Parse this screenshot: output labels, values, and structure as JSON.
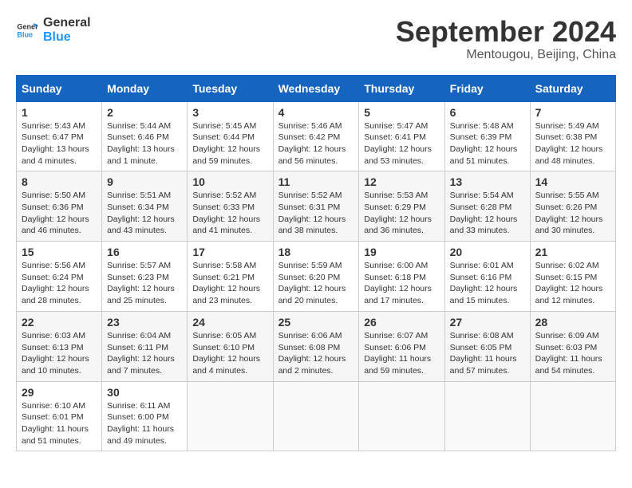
{
  "logo": {
    "line1": "General",
    "line2": "Blue"
  },
  "title": "September 2024",
  "location": "Mentougou, Beijing, China",
  "weekdays": [
    "Sunday",
    "Monday",
    "Tuesday",
    "Wednesday",
    "Thursday",
    "Friday",
    "Saturday"
  ],
  "weeks": [
    [
      {
        "day": "1",
        "info": "Sunrise: 5:43 AM\nSunset: 6:47 PM\nDaylight: 13 hours\nand 4 minutes."
      },
      {
        "day": "2",
        "info": "Sunrise: 5:44 AM\nSunset: 6:46 PM\nDaylight: 13 hours\nand 1 minute."
      },
      {
        "day": "3",
        "info": "Sunrise: 5:45 AM\nSunset: 6:44 PM\nDaylight: 12 hours\nand 59 minutes."
      },
      {
        "day": "4",
        "info": "Sunrise: 5:46 AM\nSunset: 6:42 PM\nDaylight: 12 hours\nand 56 minutes."
      },
      {
        "day": "5",
        "info": "Sunrise: 5:47 AM\nSunset: 6:41 PM\nDaylight: 12 hours\nand 53 minutes."
      },
      {
        "day": "6",
        "info": "Sunrise: 5:48 AM\nSunset: 6:39 PM\nDaylight: 12 hours\nand 51 minutes."
      },
      {
        "day": "7",
        "info": "Sunrise: 5:49 AM\nSunset: 6:38 PM\nDaylight: 12 hours\nand 48 minutes."
      }
    ],
    [
      {
        "day": "8",
        "info": "Sunrise: 5:50 AM\nSunset: 6:36 PM\nDaylight: 12 hours\nand 46 minutes."
      },
      {
        "day": "9",
        "info": "Sunrise: 5:51 AM\nSunset: 6:34 PM\nDaylight: 12 hours\nand 43 minutes."
      },
      {
        "day": "10",
        "info": "Sunrise: 5:52 AM\nSunset: 6:33 PM\nDaylight: 12 hours\nand 41 minutes."
      },
      {
        "day": "11",
        "info": "Sunrise: 5:52 AM\nSunset: 6:31 PM\nDaylight: 12 hours\nand 38 minutes."
      },
      {
        "day": "12",
        "info": "Sunrise: 5:53 AM\nSunset: 6:29 PM\nDaylight: 12 hours\nand 36 minutes."
      },
      {
        "day": "13",
        "info": "Sunrise: 5:54 AM\nSunset: 6:28 PM\nDaylight: 12 hours\nand 33 minutes."
      },
      {
        "day": "14",
        "info": "Sunrise: 5:55 AM\nSunset: 6:26 PM\nDaylight: 12 hours\nand 30 minutes."
      }
    ],
    [
      {
        "day": "15",
        "info": "Sunrise: 5:56 AM\nSunset: 6:24 PM\nDaylight: 12 hours\nand 28 minutes."
      },
      {
        "day": "16",
        "info": "Sunrise: 5:57 AM\nSunset: 6:23 PM\nDaylight: 12 hours\nand 25 minutes."
      },
      {
        "day": "17",
        "info": "Sunrise: 5:58 AM\nSunset: 6:21 PM\nDaylight: 12 hours\nand 23 minutes."
      },
      {
        "day": "18",
        "info": "Sunrise: 5:59 AM\nSunset: 6:20 PM\nDaylight: 12 hours\nand 20 minutes."
      },
      {
        "day": "19",
        "info": "Sunrise: 6:00 AM\nSunset: 6:18 PM\nDaylight: 12 hours\nand 17 minutes."
      },
      {
        "day": "20",
        "info": "Sunrise: 6:01 AM\nSunset: 6:16 PM\nDaylight: 12 hours\nand 15 minutes."
      },
      {
        "day": "21",
        "info": "Sunrise: 6:02 AM\nSunset: 6:15 PM\nDaylight: 12 hours\nand 12 minutes."
      }
    ],
    [
      {
        "day": "22",
        "info": "Sunrise: 6:03 AM\nSunset: 6:13 PM\nDaylight: 12 hours\nand 10 minutes."
      },
      {
        "day": "23",
        "info": "Sunrise: 6:04 AM\nSunset: 6:11 PM\nDaylight: 12 hours\nand 7 minutes."
      },
      {
        "day": "24",
        "info": "Sunrise: 6:05 AM\nSunset: 6:10 PM\nDaylight: 12 hours\nand 4 minutes."
      },
      {
        "day": "25",
        "info": "Sunrise: 6:06 AM\nSunset: 6:08 PM\nDaylight: 12 hours\nand 2 minutes."
      },
      {
        "day": "26",
        "info": "Sunrise: 6:07 AM\nSunset: 6:06 PM\nDaylight: 11 hours\nand 59 minutes."
      },
      {
        "day": "27",
        "info": "Sunrise: 6:08 AM\nSunset: 6:05 PM\nDaylight: 11 hours\nand 57 minutes."
      },
      {
        "day": "28",
        "info": "Sunrise: 6:09 AM\nSunset: 6:03 PM\nDaylight: 11 hours\nand 54 minutes."
      }
    ],
    [
      {
        "day": "29",
        "info": "Sunrise: 6:10 AM\nSunset: 6:01 PM\nDaylight: 11 hours\nand 51 minutes."
      },
      {
        "day": "30",
        "info": "Sunrise: 6:11 AM\nSunset: 6:00 PM\nDaylight: 11 hours\nand 49 minutes."
      },
      {
        "day": "",
        "info": ""
      },
      {
        "day": "",
        "info": ""
      },
      {
        "day": "",
        "info": ""
      },
      {
        "day": "",
        "info": ""
      },
      {
        "day": "",
        "info": ""
      }
    ]
  ]
}
